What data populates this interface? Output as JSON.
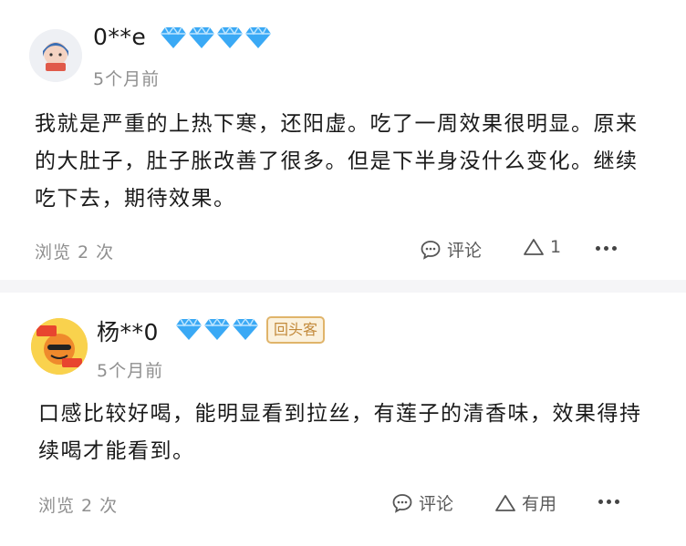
{
  "reviews": [
    {
      "username": "0**e",
      "time": "5个月前",
      "text": "我就是严重的上热下寒，还阳虚。吃了一周效果很明显。原来的大肚子，肚子胀改善了很多。但是下半身没什么变化。继续吃下去，期待效果。",
      "views": "浏览 2 次",
      "comment_label": "评论",
      "helpful_label": "1",
      "gems": 4
    },
    {
      "username": "杨**0",
      "time": "5个月前",
      "badge": "回头客",
      "text": "口感比较好喝，能明显看到拉丝，有莲子的清香味，效果得持续喝才能看到。",
      "views": "浏览 2 次",
      "comment_label": "评论",
      "helpful_label": "有用",
      "gems": 3
    }
  ],
  "icons": {
    "gem": "diamond-icon",
    "comment": "comment-bubble-icon",
    "helpful": "triangle-up-icon",
    "more": "more-dots-icon"
  },
  "colors": {
    "gem": "#3aa9f5",
    "badge_border": "#e0b46a",
    "badge_text": "#c2893a",
    "muted": "#8f8f8f"
  }
}
